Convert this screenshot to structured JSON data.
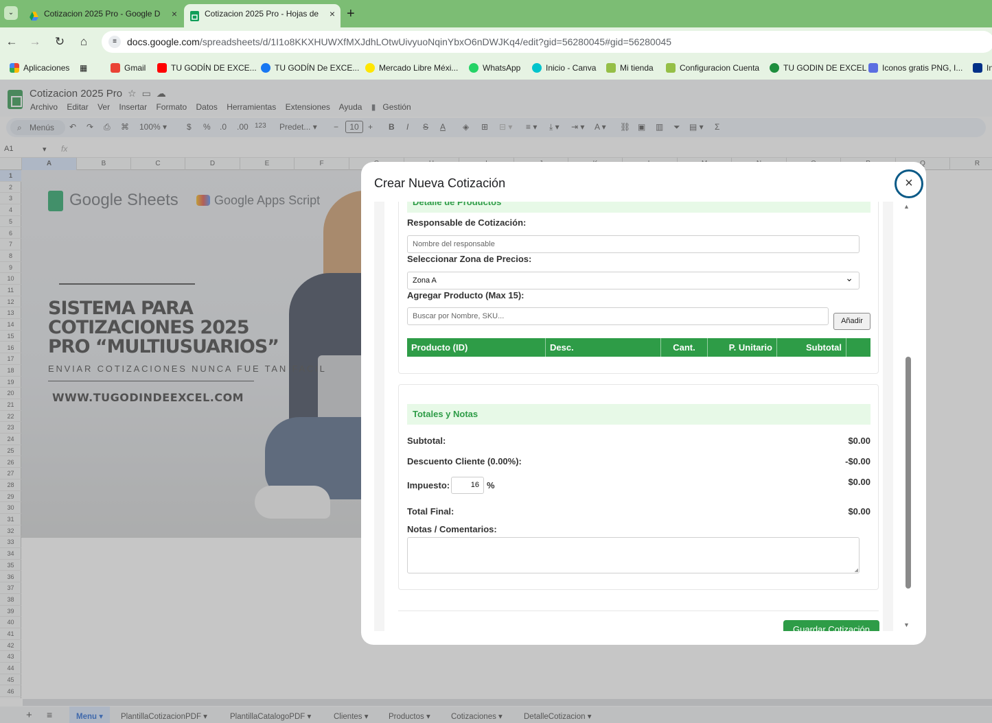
{
  "browser": {
    "tabs": [
      {
        "title": "Cotizacion 2025 Pro - Google D",
        "active": false
      },
      {
        "title": "Cotizacion 2025 Pro - Hojas de",
        "active": true
      }
    ],
    "url_domain": "docs.google.com",
    "url_path": "/spreadsheets/d/1I1o8KKXHUWXfMXJdhLOtwUivyuoNqinYbxO6nDWJKq4/edit?gid=56280045#gid=56280045",
    "bookmarks": [
      "Aplicaciones",
      "Gmail",
      "TU GODÍN DE EXCE...",
      "TU GODÍN De EXCE...",
      "Mercado Libre Méxi...",
      "WhatsApp",
      "Inicio - Canva",
      "Mi tienda",
      "Configuracion Cuenta",
      "TU GODIN DE EXCEL",
      "Iconos gratis PNG, I...",
      "In"
    ]
  },
  "sheets": {
    "doc_title": "Cotizacion 2025 Pro",
    "menus": [
      "Archivo",
      "Editar",
      "Ver",
      "Insertar",
      "Formato",
      "Datos",
      "Herramientas",
      "Extensiones",
      "Ayuda",
      "Gestión"
    ],
    "toolbar": {
      "search": "Menús",
      "zoom": "100%",
      "currency": "$",
      "percent": "%",
      "dec_dec": ".0",
      "inc_dec": ".00",
      "num_format": "123",
      "font": "Predet...",
      "font_size": "10"
    },
    "cell_ref": "A1",
    "fx": "fx",
    "columns": [
      "A",
      "B",
      "C",
      "D",
      "E",
      "F",
      "G",
      "H",
      "I",
      "J",
      "K",
      "L",
      "M",
      "N",
      "O",
      "P",
      "Q",
      "R"
    ],
    "sheet_tabs": [
      "Menu",
      "PlantillaCotizacionPDF",
      "PlantillaCatalogoPDF",
      "Clientes",
      "Productos",
      "Cotizaciones",
      "DetalleCotizacion"
    ]
  },
  "banner": {
    "gs_text": "Google Sheets",
    "gas_text": "Google Apps Script",
    "headline": "SISTEMA PARA COTIZACIONES 2025 PRO “MULTIUSUARIOS”",
    "subline": "ENVIAR COTIZACIONES NUNCA FUE TAN FACIL",
    "website": "WWW.TUGODINDEEXCEL.COM"
  },
  "modal": {
    "title": "Crear Nueva Cotización",
    "close_glyph": "×",
    "detalle": {
      "section_title": "Detalle de Productos",
      "responsable_label": "Responsable de Cotización:",
      "responsable_placeholder": "Nombre del responsable",
      "zona_label": "Seleccionar Zona de Precios:",
      "zona_value": "Zona A",
      "producto_label": "Agregar Producto (Max 15):",
      "producto_placeholder": "Buscar por Nombre, SKU...",
      "add_button": "Añadir",
      "table_headers": [
        "Producto (ID)",
        "Desc.",
        "Cant.",
        "P. Unitario",
        "Subtotal",
        ""
      ]
    },
    "totales": {
      "section_title": "Totales y Notas",
      "subtotal_label": "Subtotal:",
      "subtotal_value": "$0.00",
      "descuento_label": "Descuento Cliente (0.00%):",
      "descuento_value": "-$0.00",
      "impuesto_label": "Impuesto:",
      "impuesto_input": "16",
      "impuesto_unit": "%",
      "impuesto_value": "$0.00",
      "total_label": "Total Final:",
      "total_value": "$0.00",
      "notas_label": "Notas / Comentarios:"
    },
    "save_button": "Guardar Cotización"
  }
}
